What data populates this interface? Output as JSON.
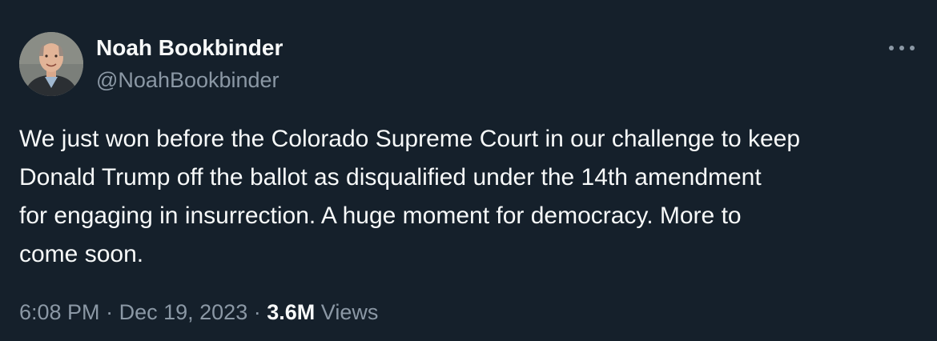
{
  "author": {
    "name": "Noah Bookbinder",
    "handle": "@NoahBookbinder",
    "avatar_icon": "profile-photo"
  },
  "more_icon": "ellipsis-icon",
  "tweet": {
    "text": "We just won before the Colorado Supreme Court in our challenge to keep\nDonald Trump off the ballot as disqualified under the 14th amendment\nfor engaging in insurrection. A huge moment for democracy. More to\ncome soon."
  },
  "meta": {
    "time": "6:08 PM",
    "separator": "·",
    "date": "Dec 19, 2023",
    "views_count": "3.6M",
    "views_label": "Views"
  },
  "colors": {
    "background": "#15202b",
    "text_primary": "#f7f9f9",
    "text_secondary": "#8b98a5"
  }
}
